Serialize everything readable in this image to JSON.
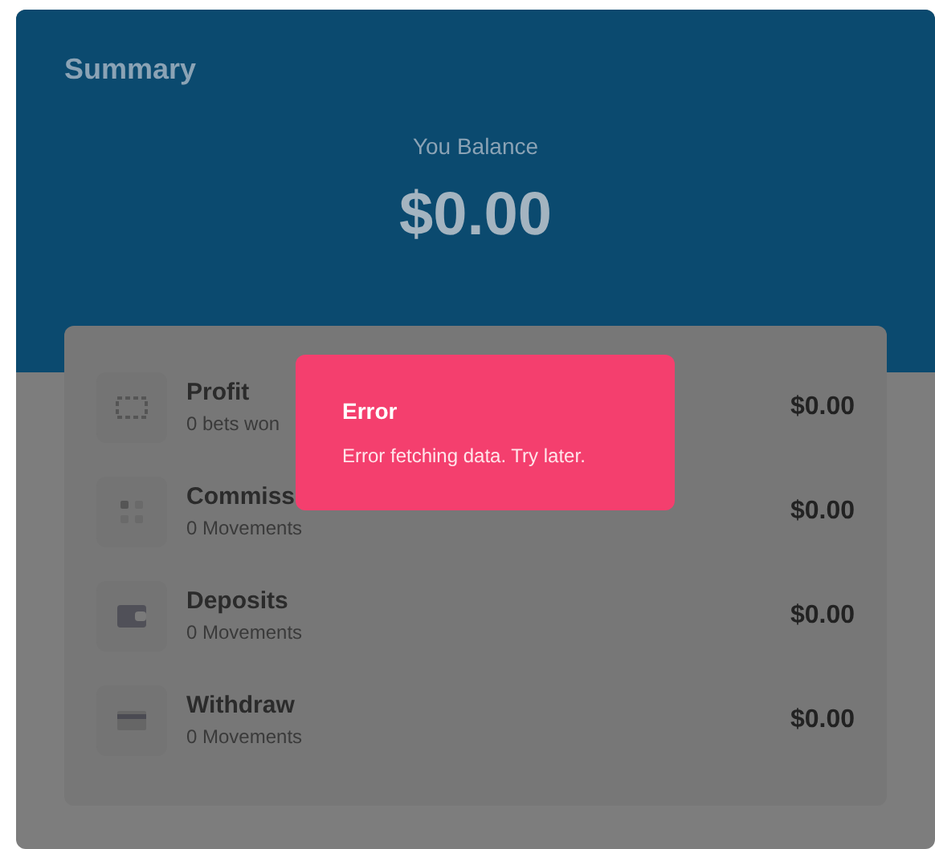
{
  "summary": {
    "title": "Summary",
    "balance_label": "You Balance",
    "balance": "$0.00"
  },
  "rows": [
    {
      "kind": "profit",
      "title": "Profit",
      "subtitle": "0 bets won",
      "amount": "$0.00"
    },
    {
      "kind": "commission",
      "title": "Commiss",
      "subtitle": "0 Movements",
      "amount": "$0.00"
    },
    {
      "kind": "deposits",
      "title": "Deposits",
      "subtitle": "0 Movements",
      "amount": "$0.00"
    },
    {
      "kind": "withdraw",
      "title": "Withdraw",
      "subtitle": "0 Movements",
      "amount": "$0.00"
    }
  ],
  "toast": {
    "title": "Error",
    "message": "Error fetching data. Try later."
  }
}
